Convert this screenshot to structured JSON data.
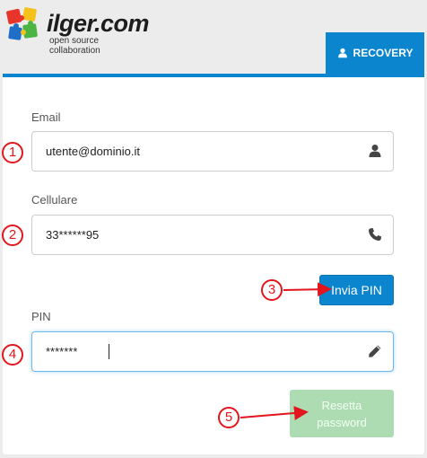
{
  "brand": {
    "name": "ilger.com",
    "tagline": "open source collaboration"
  },
  "tab": {
    "label": "RECOVERY",
    "icon": "user-icon"
  },
  "form": {
    "email": {
      "label": "Email",
      "value": "utente@dominio.it",
      "icon": "user-icon"
    },
    "phone": {
      "label": "Cellulare",
      "value": "33******95",
      "icon": "phone-icon"
    },
    "send_pin_label": "Invia PIN",
    "pin": {
      "label": "PIN",
      "value": "*******",
      "icon": "pencil-icon"
    },
    "reset_label_line1": "Resetta",
    "reset_label_line2": "password"
  },
  "annotations": {
    "step1": "1",
    "step2": "2",
    "step3": "3",
    "step4": "4",
    "step5": "5"
  },
  "colors": {
    "accent": "#0c85cf",
    "marker": "#e3151d",
    "reset_disabled": "#addcb2"
  }
}
